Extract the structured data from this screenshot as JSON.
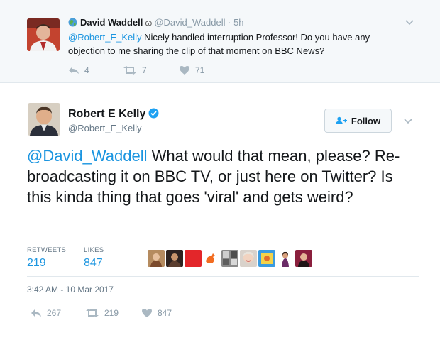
{
  "reply": {
    "name": "David Waddell",
    "handle": "@David_Waddell",
    "separator": "·",
    "time": "5h",
    "mention": "@Robert_E_Kelly",
    "text": " Nicely handled interruption Professor! Do you have any objection to me sharing the clip of that moment on BBC News?",
    "replies": "4",
    "retweets": "7",
    "likes": "71"
  },
  "tweet": {
    "name": "Robert E Kelly",
    "handle": "@Robert_E_Kelly",
    "follow_label": "Follow",
    "mention": "@David_Waddell",
    "text": " What would that mean, please? Re-broadcasting it on BBC TV, or just here on Twitter? Is this kinda thing that goes 'viral' and gets weird?",
    "retweets_label": "RETWEETS",
    "retweets": "219",
    "likes_label": "LIKES",
    "likes": "847",
    "timestamp": "3:42 AM - 10 Mar 2017",
    "action_replies": "267",
    "action_retweets": "219",
    "action_likes": "847"
  },
  "colors": {
    "link": "#1b95e0",
    "muted": "#8899a6",
    "verified": "#1da1f2",
    "reply_bg": "#f5f8fa"
  },
  "icons": [
    "globe-icon",
    "chevron-down-icon",
    "reply-icon",
    "retweet-icon",
    "heart-icon",
    "verified-badge-icon",
    "follow-person-icon"
  ]
}
